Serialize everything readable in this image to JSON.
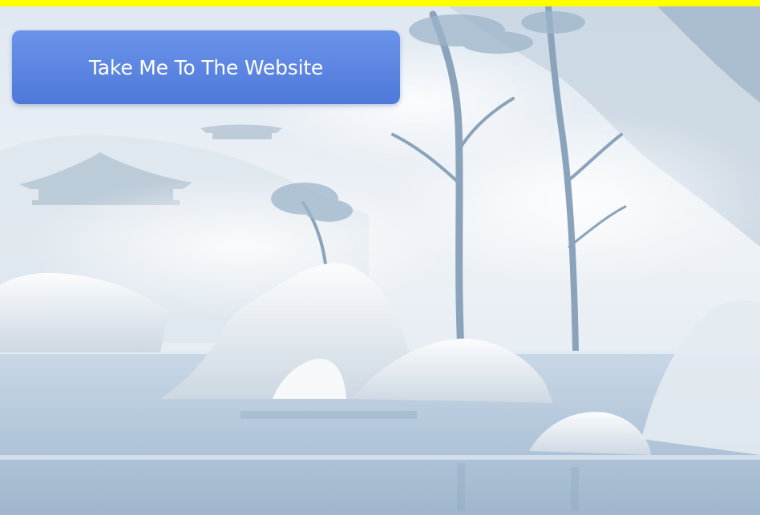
{
  "colors": {
    "top_bar": "#ffff00",
    "button_top": "#6a93ea",
    "button_bottom": "#4f79d9",
    "sky": "#eef3f8",
    "water": "#b9cde0",
    "rock": "#f2f5f8",
    "tree": "#7f9cb7"
  },
  "button": {
    "label": "Take Me To The Website",
    "icon": "none"
  },
  "background": {
    "icon": "misty-lake-landscape-illustration"
  }
}
